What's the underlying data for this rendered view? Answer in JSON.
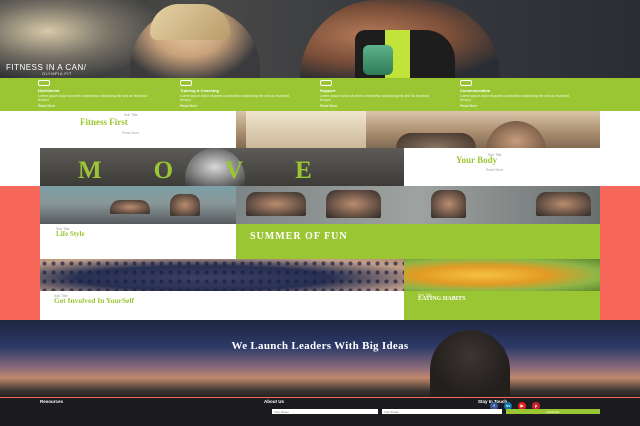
{
  "hero": {
    "title": "FITNESS IN A CAN/",
    "subtitle": "OLYMPIA FIT"
  },
  "features": [
    {
      "title": "Nutritionist",
      "text": "Lorem ipsum dolor sit amet consectetur adipiscing elit sed do eiusmod tempor",
      "more": "Read More"
    },
    {
      "title": "Training & Coaching",
      "text": "Lorem ipsum dolor sit amet consectetur adipiscing elit sed do eiusmod tempor",
      "more": "Read More"
    },
    {
      "title": "Support",
      "text": "Lorem ipsum dolor sit amet consectetur adipiscing elit sed do eiusmod tempor",
      "more": "Read More"
    },
    {
      "title": "Communication",
      "text": "Lorem ipsum dolor sit amet consectetur adipiscing elit sed do eiusmod tempor",
      "more": "Read More"
    }
  ],
  "tiles": {
    "fitness": {
      "kicker": "Sub Title",
      "title": "Fitness First",
      "more": "Read More"
    },
    "move": "MOVE",
    "body": {
      "kicker": "Sub Title",
      "title": "Your Body",
      "more": "Read More"
    },
    "life": {
      "kicker": "Sub Title",
      "title": "Life Style"
    },
    "summer": "SUMMER OF FUN",
    "involved": {
      "kicker": "Sub Title",
      "title": "Get Involved In YourSelf"
    },
    "eating": {
      "kicker": "Sub Title",
      "title": "EATING HABITS"
    }
  },
  "banner": {
    "title": "We Launch Leaders With Big Ideas"
  },
  "footer": {
    "resources": "Resources",
    "about": "About Us",
    "touch": "Stay In Touch",
    "name_placeholder": "Your Name",
    "email_placeholder": "Your Email",
    "subscribe": "Subscribe",
    "social": [
      {
        "icon": "facebook-icon",
        "glyph": "f",
        "color": "#3b5998"
      },
      {
        "icon": "linkedin-icon",
        "glyph": "in",
        "color": "#0e76a8"
      },
      {
        "icon": "youtube-icon",
        "glyph": "▶",
        "color": "#e62117"
      },
      {
        "icon": "pinterest-icon",
        "glyph": "p",
        "color": "#cb2027"
      }
    ]
  },
  "colors": {
    "green": "#9bc634",
    "coral": "#f7675a",
    "dark": "#1c1b20"
  }
}
